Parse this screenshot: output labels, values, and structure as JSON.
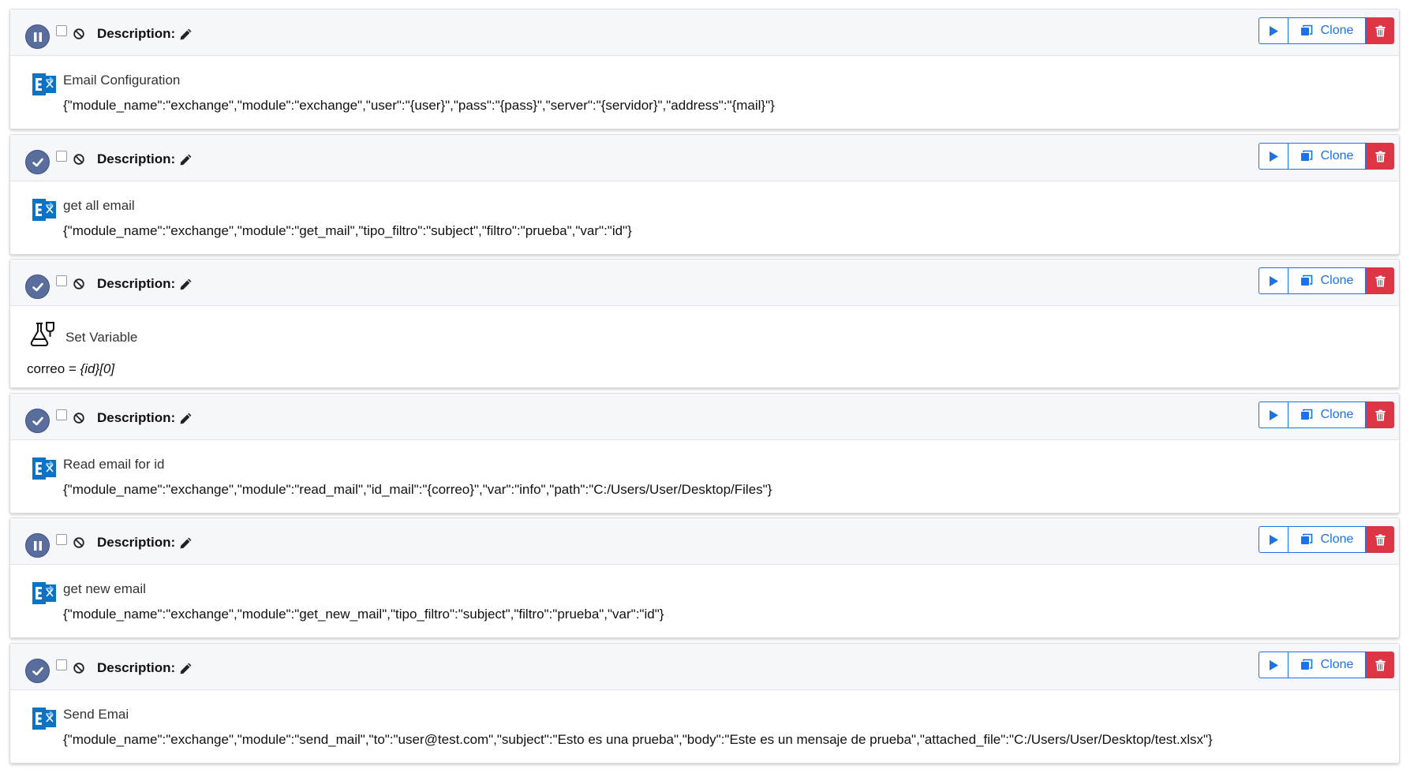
{
  "labels": {
    "description": "Description:",
    "clone": "Clone"
  },
  "colors": {
    "status_fill": "#5a6e9e",
    "primary": "#1a73e8",
    "danger": "#dc3545",
    "exchange_blue": "#0b72c6"
  },
  "steps": [
    {
      "status": "paused",
      "icon": "exchange-icon",
      "title": "Email Configuration",
      "json": "{\"module_name\":\"exchange\",\"module\":\"exchange\",\"user\":\"{user}\",\"pass\":\"{pass}\",\"server\":\"{servidor}\",\"address\":\"{mail}\"}"
    },
    {
      "status": "enabled",
      "icon": "exchange-icon",
      "title": "get all email",
      "json": "{\"module_name\":\"exchange\",\"module\":\"get_mail\",\"tipo_filtro\":\"subject\",\"filtro\":\"prueba\",\"var\":\"id\"}"
    },
    {
      "status": "enabled",
      "icon": "flask-icon",
      "title": "Set Variable",
      "var_name": "correo",
      "operator": "=",
      "var_value": "{id}[0]"
    },
    {
      "status": "enabled",
      "icon": "exchange-icon",
      "title": "Read email for id",
      "json": "{\"module_name\":\"exchange\",\"module\":\"read_mail\",\"id_mail\":\"{correo}\",\"var\":\"info\",\"path\":\"C:/Users/User/Desktop/Files\"}"
    },
    {
      "status": "paused",
      "icon": "exchange-icon",
      "title": "get new email",
      "json": "{\"module_name\":\"exchange\",\"module\":\"get_new_mail\",\"tipo_filtro\":\"subject\",\"filtro\":\"prueba\",\"var\":\"id\"}"
    },
    {
      "status": "enabled",
      "icon": "exchange-icon",
      "title": "Send Emai",
      "json": "{\"module_name\":\"exchange\",\"module\":\"send_mail\",\"to\":\"user@test.com\",\"subject\":\"Esto es una prueba\",\"body\":\"Este es un mensaje de prueba\",\"attached_file\":\"C:/Users/User/Desktop/test.xlsx\"}"
    }
  ]
}
